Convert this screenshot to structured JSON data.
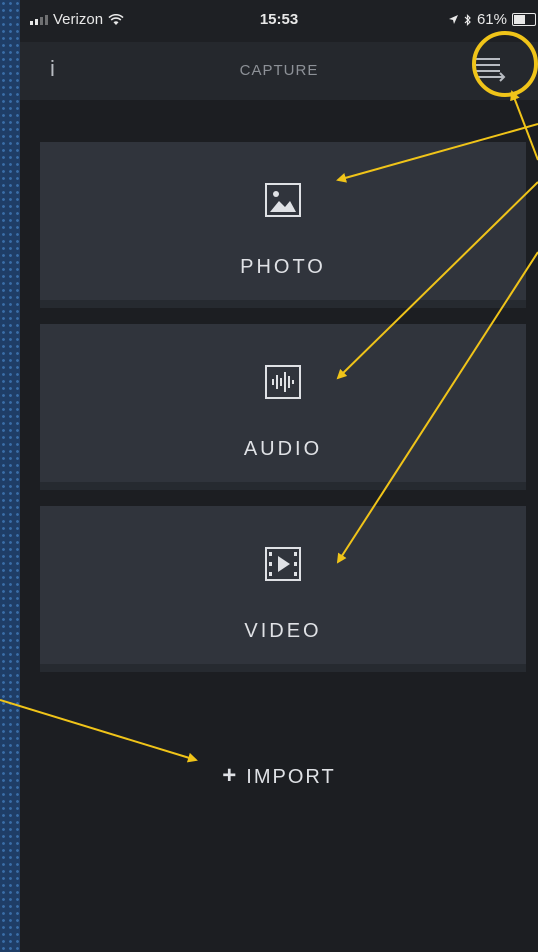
{
  "status_bar": {
    "carrier": "Verizon",
    "time": "15:53",
    "battery": "61%",
    "battery_level": 0.61
  },
  "nav": {
    "info_label": "i",
    "title": "CAPTURE",
    "menu_icon": "menu-arrow-icon"
  },
  "tiles": [
    {
      "label": "PHOTO",
      "icon": "image-icon"
    },
    {
      "label": "AUDIO",
      "icon": "audio-waveform-icon"
    },
    {
      "label": "VIDEO",
      "icon": "film-play-icon"
    }
  ],
  "import": {
    "plus": "+",
    "label": "IMPORT"
  },
  "colors": {
    "accent_annotation": "#f0c419",
    "background_pattern": "#1f3d66",
    "tile": "#30343c",
    "app_bg": "#1c1e22"
  }
}
